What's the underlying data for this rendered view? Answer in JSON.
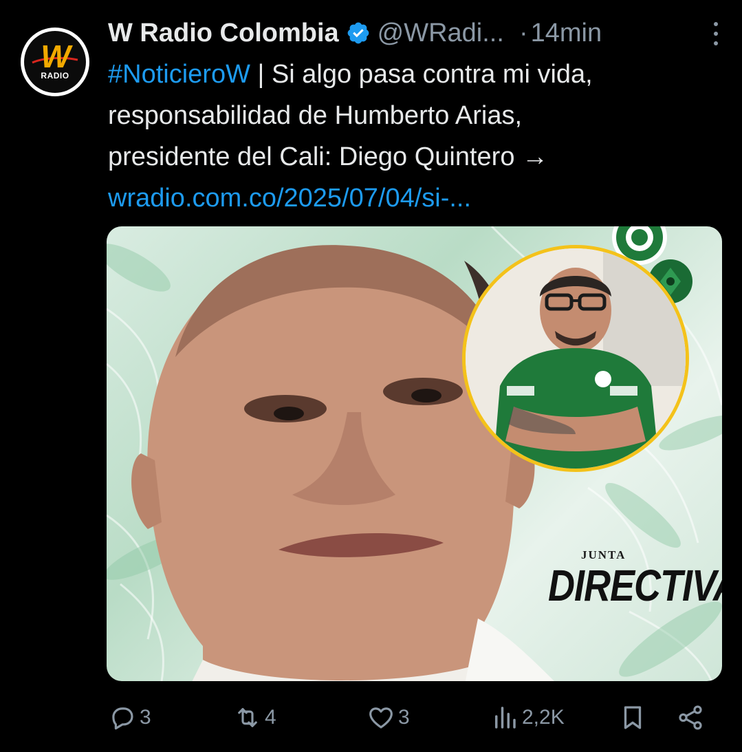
{
  "account": {
    "display_name": "W Radio Colombia",
    "handle": "@WRadi...",
    "separator": "·",
    "time_ago": "14min",
    "avatar_logo_text": "W",
    "avatar_logo_subtext": "RADIO"
  },
  "tweet": {
    "hashtag": "#NoticieroW",
    "text_line1_rest": " | Si algo pasa contra mi vida,",
    "text_line2": "responsabilidad de Humberto Arias,",
    "text_line3": "presidente del Cali: Diego Quintero →",
    "link": "wradio.com.co/2025/07/04/si-..."
  },
  "media": {
    "overlay_small": "JUNTA",
    "overlay_large": "DIRECTIVA"
  },
  "actions": {
    "replies": "3",
    "reposts": "4",
    "likes": "3",
    "views": "2,2K"
  },
  "colors": {
    "background": "#000000",
    "text": "#e7e9ea",
    "secondary": "#8b98a5",
    "link": "#1d9bf0",
    "verified": "#1d9bf0",
    "inset_ring": "#f4c21a"
  },
  "icons": {
    "reply": "speech-bubble-icon",
    "repost": "repost-arrows-icon",
    "like": "heart-icon",
    "views": "bar-chart-icon",
    "bookmark": "bookmark-icon",
    "share": "share-icon",
    "more": "more-vertical-icon",
    "verified": "verified-badge-icon"
  }
}
